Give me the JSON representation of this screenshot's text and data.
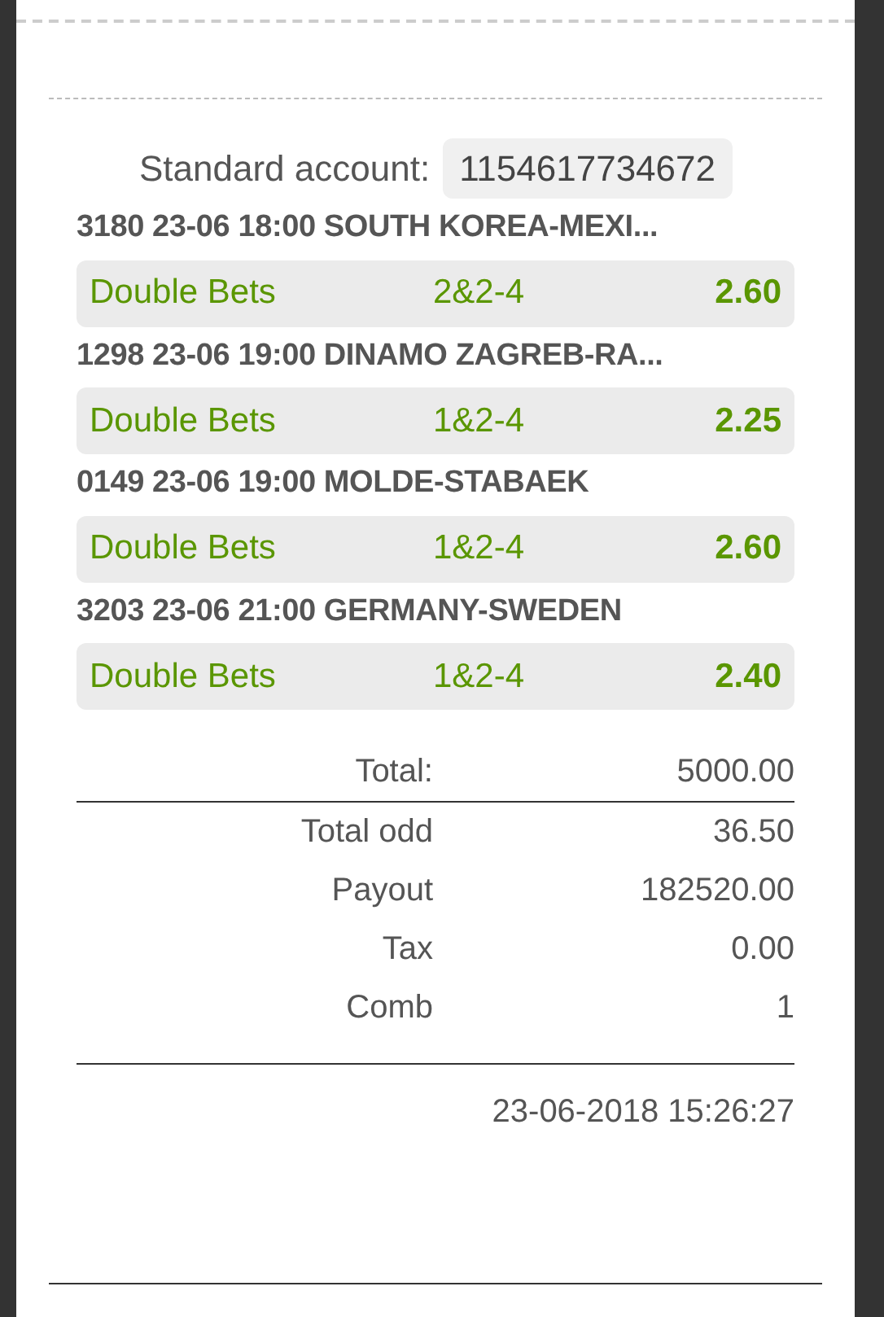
{
  "account": {
    "label": "Standard account:",
    "number": "1154617734672"
  },
  "bets": [
    {
      "match": "3180 23-06 18:00 SOUTH KOREA-MEXI...",
      "type": "Double Bets",
      "pick": "2&2-4",
      "odd": "2.60"
    },
    {
      "match": "1298 23-06 19:00 DINAMO ZAGREB-RA...",
      "type": "Double Bets",
      "pick": "1&2-4",
      "odd": "2.25"
    },
    {
      "match": "0149 23-06 19:00 MOLDE-STABAEK",
      "type": "Double Bets",
      "pick": "1&2-4",
      "odd": "2.60"
    },
    {
      "match": "3203 23-06 21:00 GERMANY-SWEDEN",
      "type": "Double Bets",
      "pick": "1&2-4",
      "odd": "2.40"
    }
  ],
  "summary": [
    {
      "label": "Total:",
      "value": "5000.00"
    },
    {
      "label": "Total odd",
      "value": "36.50"
    },
    {
      "label": "Payout",
      "value": "182520.00"
    },
    {
      "label": "Tax",
      "value": "0.00"
    },
    {
      "label": "Comb",
      "value": "1"
    }
  ],
  "timestamp": "23-06-2018 15:26:27"
}
